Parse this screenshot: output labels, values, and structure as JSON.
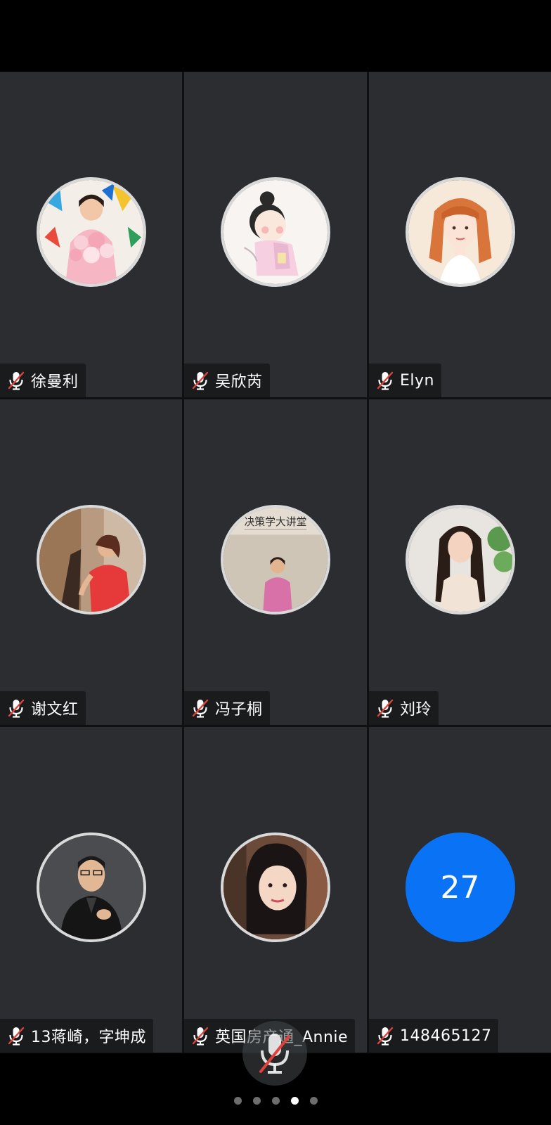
{
  "participants": [
    {
      "name": "徐曼利",
      "avatar": "photo-woman-with-flowers",
      "mic": "muted"
    },
    {
      "name": "吴欣芮",
      "avatar": "cartoon-girl-hanfu",
      "mic": "muted"
    },
    {
      "name": "Elyn",
      "avatar": "illustrated-woman-orange-hair",
      "mic": "muted"
    },
    {
      "name": "谢文红",
      "avatar": "photo-woman-red-shirt",
      "mic": "muted"
    },
    {
      "name": "冯子桐",
      "avatar": "photo-woman-before-sign",
      "avatar_sign_text": "决策学大讲堂",
      "mic": "muted"
    },
    {
      "name": "刘玲",
      "avatar": "photo-woman-long-hair",
      "mic": "muted"
    },
    {
      "name": "13蒋崎，字坤成",
      "avatar": "photo-man-suit",
      "mic": "muted"
    },
    {
      "name": "英国房产通_Annie",
      "avatar": "photo-woman-selfie",
      "mic": "muted"
    },
    {
      "name": "148465127",
      "avatar_number": "27",
      "avatar_color": "#0a72f5",
      "mic": "muted"
    }
  ],
  "bottom_bar": {
    "mic_button": "mic-off-icon"
  },
  "pager": {
    "pages": 5,
    "current_page": 4
  },
  "colors": {
    "background": "#000000",
    "tile": "#2b2d30",
    "muted_slash": "#e0423c",
    "number_avatar": "#0a72f5"
  }
}
